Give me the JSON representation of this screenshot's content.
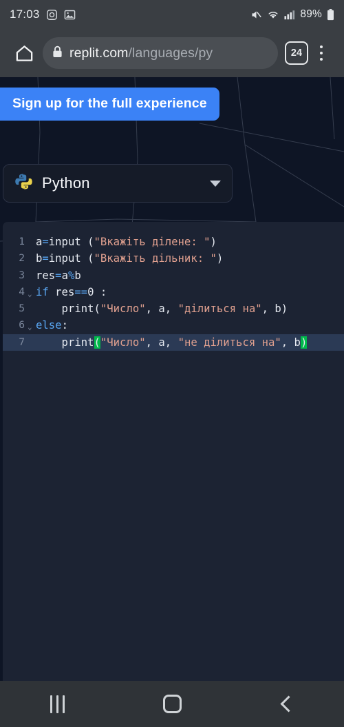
{
  "status_bar": {
    "time": "17:03",
    "battery_text": "89%",
    "left_icons": [
      "instagram-icon",
      "gallery-icon"
    ],
    "right_icons": [
      "mute-icon",
      "wifi-icon",
      "cellular-signal-icon",
      "battery-icon"
    ]
  },
  "browser": {
    "home_icon": "home-icon",
    "lock_icon": "lock-icon",
    "url_secure": "replit.com",
    "url_path": "/languages/py",
    "tab_count": "24",
    "menu_icon": "kebab-menu-icon"
  },
  "page": {
    "signup_button": "Sign up for the full experience",
    "language_selector": {
      "icon": "python-logo-icon",
      "value": "Python",
      "caret": "chevron-down-icon"
    }
  },
  "editor": {
    "active_line": 7,
    "lines": [
      {
        "num": "1",
        "fold": "",
        "active": false,
        "tokens": [
          {
            "t": "a",
            "c": "plain"
          },
          {
            "t": "=",
            "c": "op"
          },
          {
            "t": "input (",
            "c": "plain"
          },
          {
            "t": "\"Вкажіть ділене: \"",
            "c": "str"
          },
          {
            "t": ")",
            "c": "plain"
          }
        ],
        "text": "a=input (\"Вкажіть ділене: \")"
      },
      {
        "num": "2",
        "fold": "",
        "active": false,
        "tokens": [
          {
            "t": "b",
            "c": "plain"
          },
          {
            "t": "=",
            "c": "op"
          },
          {
            "t": "input (",
            "c": "plain"
          },
          {
            "t": "\"Вкажіть дільник: \"",
            "c": "str"
          },
          {
            "t": ")",
            "c": "plain"
          }
        ],
        "text": "b=input (\"Вкажіть дільник: \")"
      },
      {
        "num": "3",
        "fold": "",
        "active": false,
        "tokens": [
          {
            "t": "res",
            "c": "plain"
          },
          {
            "t": "=",
            "c": "op"
          },
          {
            "t": "a",
            "c": "plain"
          },
          {
            "t": "%",
            "c": "op"
          },
          {
            "t": "b",
            "c": "plain"
          }
        ],
        "text": "res=a%b"
      },
      {
        "num": "4",
        "fold": "⌄",
        "active": false,
        "tokens": [
          {
            "t": "if",
            "c": "kw"
          },
          {
            "t": " res",
            "c": "plain"
          },
          {
            "t": "==",
            "c": "op"
          },
          {
            "t": "0",
            "c": "plain"
          },
          {
            "t": " :",
            "c": "plain"
          }
        ],
        "text": "if res==0 :"
      },
      {
        "num": "5",
        "fold": "",
        "active": false,
        "tokens": [
          {
            "t": "    print(",
            "c": "plain"
          },
          {
            "t": "\"Число\"",
            "c": "str"
          },
          {
            "t": ", a, ",
            "c": "plain"
          },
          {
            "t": "\"ділиться на\"",
            "c": "str"
          },
          {
            "t": ", b)",
            "c": "plain"
          }
        ],
        "text": "    print(\"Число\", a, \"ділиться на\", b)"
      },
      {
        "num": "6",
        "fold": "⌄",
        "active": false,
        "tokens": [
          {
            "t": "else",
            "c": "kw"
          },
          {
            "t": ":",
            "c": "plain"
          }
        ],
        "text": "else:"
      },
      {
        "num": "7",
        "fold": "",
        "active": true,
        "tokens": [
          {
            "t": "    print",
            "c": "plain"
          },
          {
            "t": "(",
            "c": "brk"
          },
          {
            "t": "\"Число\"",
            "c": "str"
          },
          {
            "t": ", a, ",
            "c": "plain"
          },
          {
            "t": "\"не ділиться на\"",
            "c": "str"
          },
          {
            "t": ", b",
            "c": "plain"
          },
          {
            "t": ")",
            "c": "brk"
          }
        ],
        "text": "    print(\"Число\", a, \"не ділиться на\", b)"
      }
    ]
  },
  "nav_bar": {
    "recents_icon": "recents-icon",
    "home_icon": "home-square-icon",
    "back_icon": "back-chevron-icon"
  },
  "colors": {
    "page_background": "#0e1525",
    "editor_background": "#1c2333",
    "accent_blue": "#3b82f6",
    "string_color": "#e0a08f",
    "keyword_color": "#5aa8f5",
    "bracket_match": "#00b84a",
    "chrome_gray": "#3a3e43",
    "navbar_gray": "#2f3337"
  }
}
